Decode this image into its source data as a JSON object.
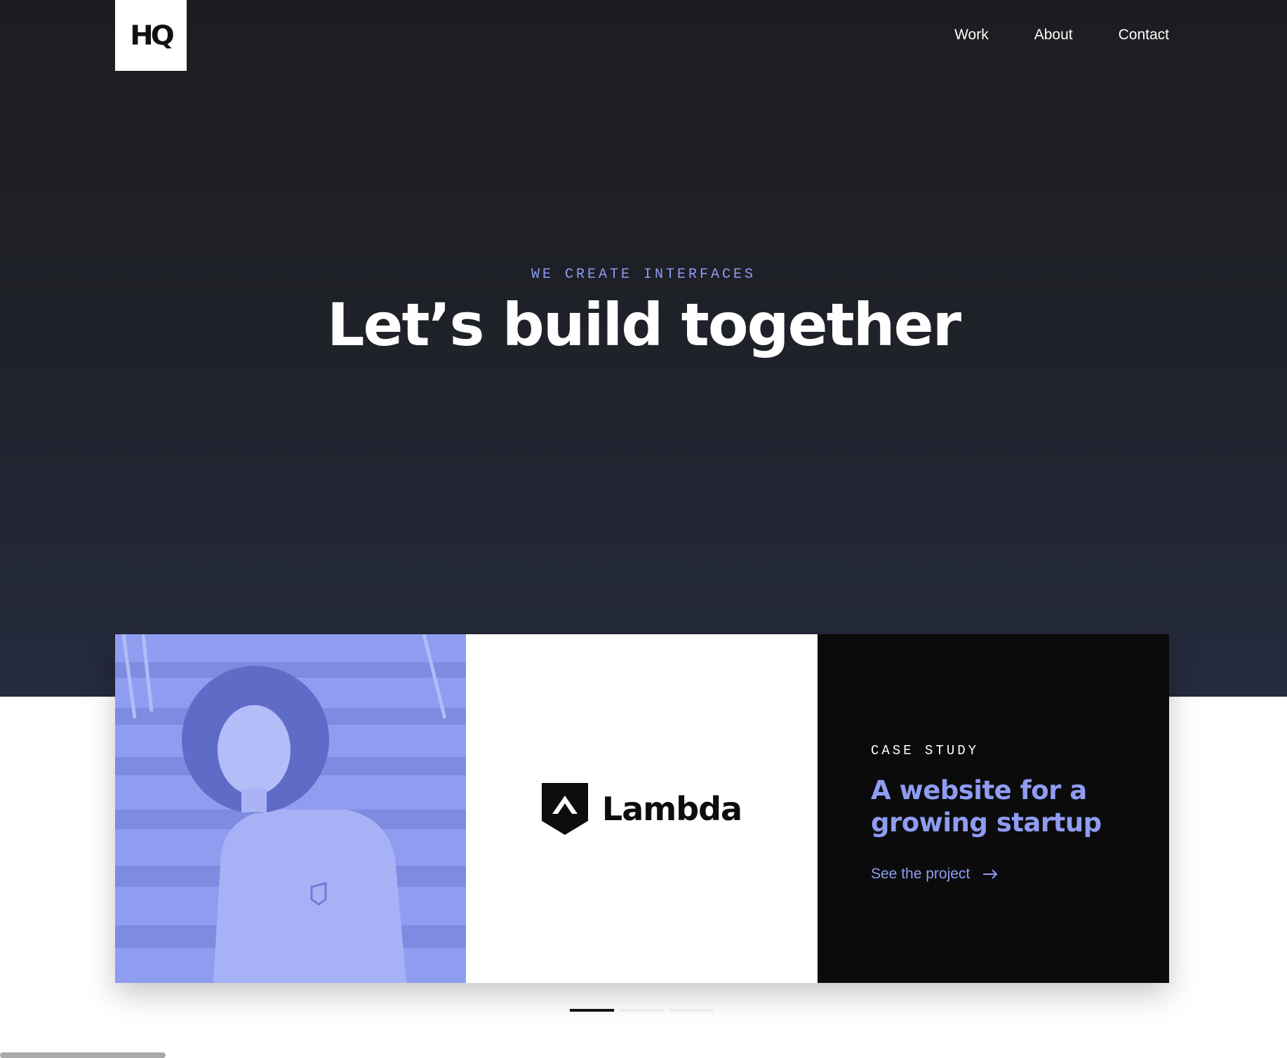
{
  "logo": {
    "text": "HQ"
  },
  "nav": {
    "items": [
      "Work",
      "About",
      "Contact"
    ]
  },
  "hero": {
    "eyebrow": "WE CREATE INTERFACES",
    "title": "Let’s build together"
  },
  "card": {
    "brand_name": "Lambda",
    "eyebrow": "CASE STUDY",
    "title": "A website for a growing startup",
    "link_label": "See the project"
  },
  "carousel": {
    "slide_count": 3,
    "active_index": 0
  },
  "colors": {
    "accent": "#8f9cf2",
    "hero_bg": "#1f2128",
    "card_dark": "#0b0b0c",
    "photo_tint": "#8f9df0"
  }
}
